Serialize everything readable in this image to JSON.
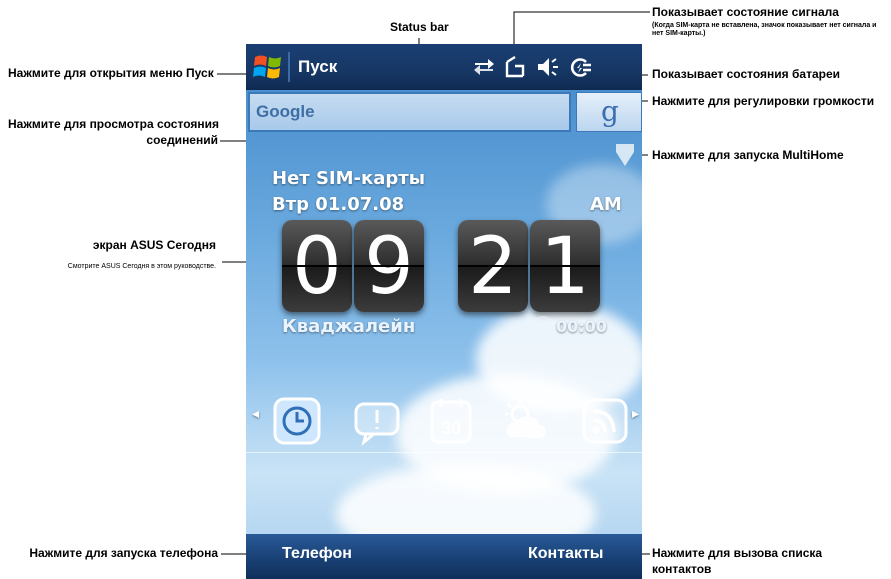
{
  "annotations": {
    "status_bar": "Status bar",
    "signal_title": "Показывает состояние сигнала",
    "signal_note": "(Когда SIM-карта не вставлена, значок показывает нет сигнала и нет SIM-карты.)",
    "start_menu": "Нажмите для открытия меню Пуск",
    "battery": "Показывает состояния батареи",
    "volume": "Нажмите для регулировки громкости",
    "connections_line1": "Нажмите для просмотра состояния",
    "connections_line2": "соединений",
    "multihome": "Нажмите для запуска MultiHome",
    "today_title": "экран ASUS Сегодня",
    "today_note": "Смотрите ASUS Сегодня в этом руководстве.",
    "phone": "Нажмите для запуска телефона",
    "contacts_line1": "Нажмите для вызова списка",
    "contacts_line2": "контактов"
  },
  "screen": {
    "start_label": "Пуск",
    "search_placeholder": "Google",
    "search_button": "g",
    "sim_status": "Нет SIM-карты",
    "date": "Втр 01.07.08",
    "ampm": "AM",
    "clock": {
      "h1": "0",
      "h2": "9",
      "m1": "2",
      "m2": "1"
    },
    "location": "Кваджалейн",
    "alarm_time": "00:00",
    "softkey_left": "Телефон",
    "softkey_right": "Контакты"
  },
  "icons": {
    "status": [
      "connectivity-icon",
      "no-signal-icon",
      "volume-icon",
      "battery-icon"
    ],
    "apps": [
      "clock-icon",
      "message-icon",
      "calendar-icon",
      "weather-icon",
      "rss-icon"
    ],
    "calendar_day": "30"
  }
}
